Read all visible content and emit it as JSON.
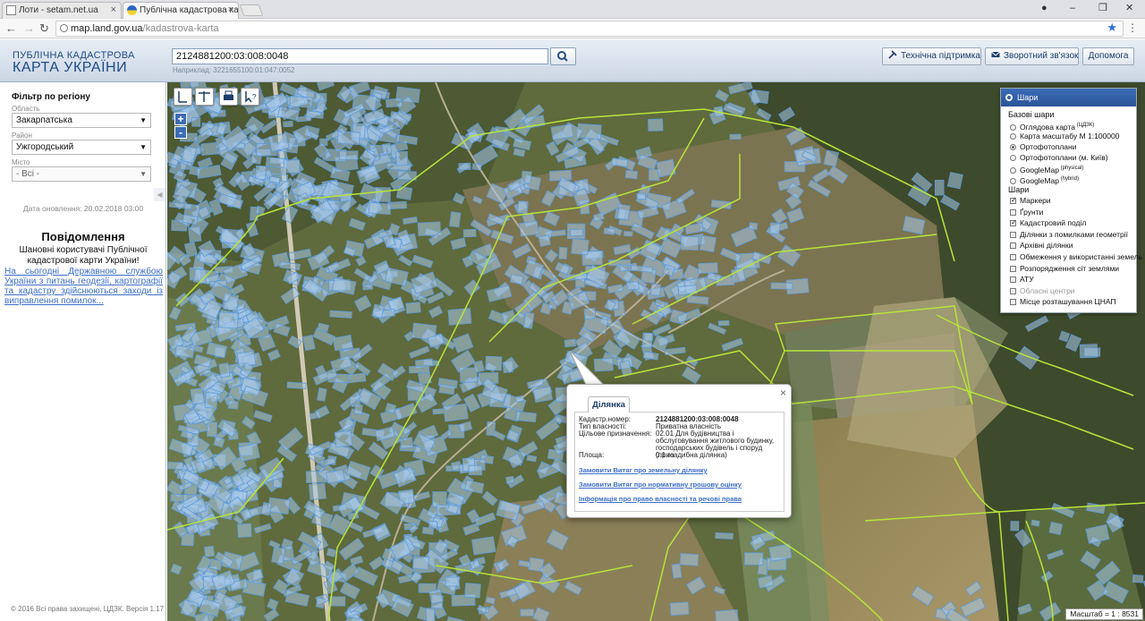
{
  "browser": {
    "tabs": [
      {
        "title": "Лоти - setam.net.ua"
      },
      {
        "title": "Публічна кадастрова ка"
      }
    ],
    "address": {
      "host": "map.land.gov.ua",
      "path": "/kadastrova-karta"
    }
  },
  "header": {
    "title_line1": "ПУБЛІЧНА КАДАСТРОВА",
    "title_line2": "КАРТА УКРАЇНИ",
    "search_value": "2124881200:03:008:0048",
    "search_example": "Наприклад: 3221655100:01:047:0052",
    "buttons": {
      "support": "Технічна підтримка",
      "feedback": "Зворотний зв'язок",
      "help": "Допомога"
    }
  },
  "sidebar": {
    "filter_title": "Фільтр по регіону",
    "oblast_label": "Область",
    "oblast_value": "Закарпатська",
    "raion_label": "Район",
    "raion_value": "Ужгородський",
    "city_label": "Місто",
    "city_value": "- Всі -",
    "update_date": "Дата оновлення: 20.02.2018 03:00",
    "notice_title": "Повідомлення",
    "notice_greeting": "Шановні користувачі Публічної кадастрової карти України!",
    "notice_link": "На сьогодні Державною службою України з питань геодезії, картографії та кадастру здійснюються заходи із виправлення помилок...",
    "copyright": "© 2016 Всі права захищені, ЦДЗК. Версія 1.17"
  },
  "layers": {
    "title": "Шари",
    "base_title": "Базові шари",
    "base": [
      {
        "label": "Оглядова карта",
        "sup": "(ЦДЗК)",
        "on": false
      },
      {
        "label": "Карта масштабу М 1:100000",
        "sup": "",
        "on": false
      },
      {
        "label": "Ортофотоплани",
        "sup": "",
        "on": true
      },
      {
        "label": "Ортофотоплани (м. Київ)",
        "sup": "",
        "on": false
      },
      {
        "label": "GoogleMap",
        "sup": "(physical)",
        "on": false
      },
      {
        "label": "GoogleMap",
        "sup": "(hybrid)",
        "on": false
      }
    ],
    "overlay_title": "Шари",
    "overlays": [
      {
        "label": "Маркери",
        "on": true
      },
      {
        "label": "Ґрунти",
        "on": false
      },
      {
        "label": "Кадастровий поділ",
        "on": true
      },
      {
        "label": "Ділянки з помилками геометрії",
        "on": false
      },
      {
        "label": "Архівні ділянки",
        "on": false
      },
      {
        "label": "Обмеження у використанні земель",
        "on": false
      },
      {
        "label": "Розпорядження сіт землями",
        "on": false
      },
      {
        "label": "АТУ",
        "on": false
      },
      {
        "label": "Обласні центри",
        "on": false,
        "disabled": true
      },
      {
        "label": "Місце розташування ЦНАП",
        "on": false
      }
    ]
  },
  "popup": {
    "tab": "Ділянка",
    "rows": [
      {
        "label": "Кадастр.номер:",
        "value": "2124881200:03:008:0048"
      },
      {
        "label": "Тип власності:",
        "value": "Приватна власність"
      },
      {
        "label": "Цільове призначення:",
        "value": "02.01 Для будівництва і обслуговування житлового будинку, господарських будівель і споруд (присадибна ділянка)"
      },
      {
        "label": "Площа:",
        "value": "0.1 га"
      }
    ],
    "links": [
      "Замовити Витяг про земельну ділянку",
      "Замовити Витяг про нормативну грошову оцінку",
      "Інформація про право власності та речові права"
    ]
  },
  "map": {
    "scale": "Масштаб = 1 : 8531",
    "zoom_in": "+",
    "zoom_out": "-"
  },
  "colors": {
    "parcel_fill": "#a7c8ea",
    "parcel_stroke": "#5d9ad6",
    "boundary": "#b6e33a",
    "accent": "#3c6cb5"
  }
}
